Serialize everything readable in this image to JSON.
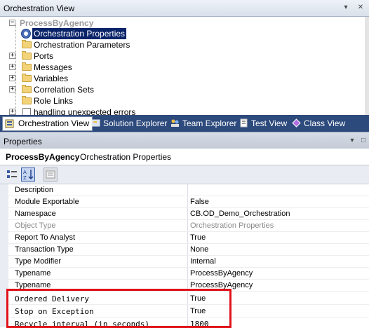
{
  "orchestration_view": {
    "title": "Orchestration View",
    "root": "ProcessByAgency",
    "items": [
      {
        "label": "Orchestration Properties",
        "icon": "gear-icon",
        "selected": true,
        "expandable": false
      },
      {
        "label": "Orchestration Parameters",
        "icon": "folder-icon",
        "expandable": false
      },
      {
        "label": "Ports",
        "icon": "folder-icon",
        "expandable": true
      },
      {
        "label": "Messages",
        "icon": "folder-icon",
        "expandable": true
      },
      {
        "label": "Variables",
        "icon": "folder-icon",
        "expandable": true
      },
      {
        "label": "Correlation Sets",
        "icon": "folder-icon",
        "expandable": true
      },
      {
        "label": "Role Links",
        "icon": "folder-icon",
        "expandable": false
      },
      {
        "label": "handling unexpected errors",
        "icon": "doc-icon",
        "expandable": true
      }
    ]
  },
  "tabs": [
    {
      "label": "Orchestration View",
      "active": true,
      "icon": "orchestration-view-icon"
    },
    {
      "label": "Solution Explorer",
      "icon": "solution-explorer-icon"
    },
    {
      "label": "Team Explorer",
      "icon": "team-explorer-icon"
    },
    {
      "label": "Test View",
      "icon": "test-view-icon"
    },
    {
      "label": "Class View",
      "icon": "class-view-icon"
    }
  ],
  "properties": {
    "title": "Properties",
    "object_name": "ProcessByAgency",
    "object_type": "Orchestration Properties",
    "rows": [
      {
        "name": "Description",
        "value": ""
      },
      {
        "name": "Module Exportable",
        "value": "False"
      },
      {
        "name": "Namespace",
        "value": "CB.OD_Demo_Orchestration"
      },
      {
        "name": "Object Type",
        "value": "Orchestration Properties",
        "dim": true
      },
      {
        "name": "Report To Analyst",
        "value": "True"
      },
      {
        "name": "Transaction Type",
        "value": "None"
      },
      {
        "name": "Type Modifier",
        "value": "Internal"
      },
      {
        "name": "Typename",
        "value": "ProcessByAgency"
      },
      {
        "name": "Typename",
        "value": "ProcessByAgency"
      },
      {
        "name": "Ordered Delivery",
        "value": "True",
        "mono": true
      },
      {
        "name": "Stop on Exception",
        "value": "True",
        "mono": true
      },
      {
        "name": "Recycle interval (in seconds)",
        "value": "1800",
        "mono": true
      }
    ]
  },
  "colors": {
    "tab_strip": "#2d4a7c",
    "selection": "#0a246a",
    "highlight_border": "#e0121a"
  }
}
